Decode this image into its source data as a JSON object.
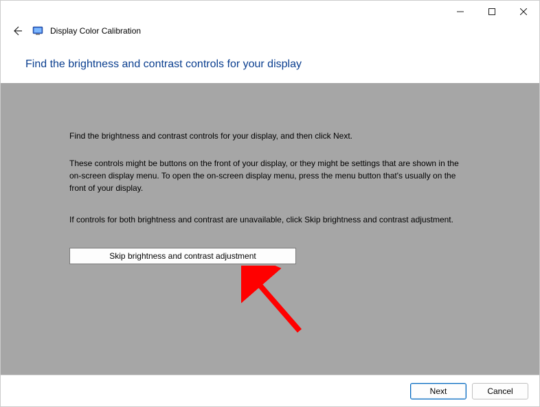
{
  "window": {
    "app_name": "Display Color Calibration"
  },
  "page": {
    "title": "Find the brightness and contrast controls for your display"
  },
  "content": {
    "p1": "Find the brightness and contrast controls for your display, and then click Next.",
    "p2": "These controls might be buttons on the front of your display, or they might be settings that are shown in the on-screen display menu. To open the on-screen display menu, press the menu button that's usually on the front of your display.",
    "p3": "If controls for both brightness and contrast are unavailable, click Skip brightness and contrast adjustment.",
    "skip_button": "Skip brightness and contrast adjustment"
  },
  "footer": {
    "next": "Next",
    "cancel": "Cancel"
  }
}
